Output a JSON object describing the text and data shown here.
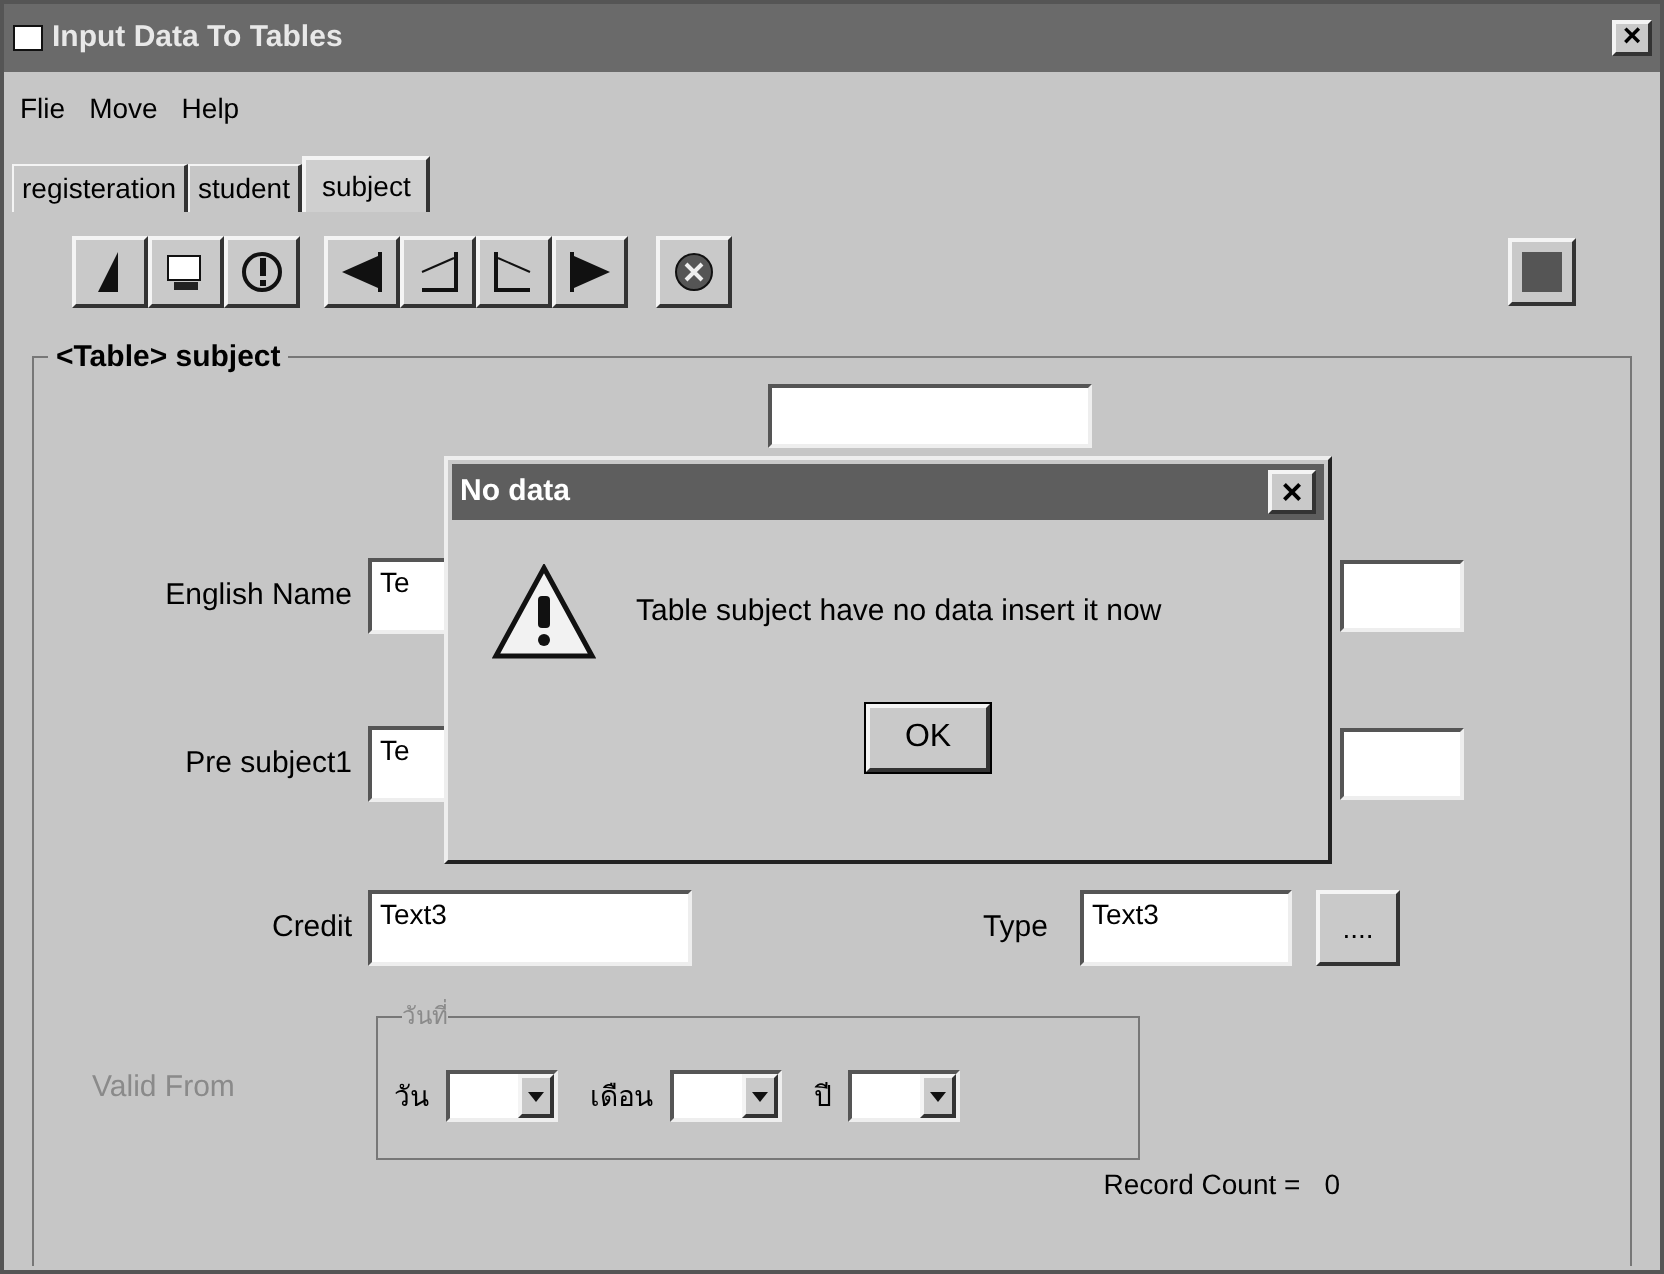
{
  "window": {
    "title": "Input Data To Tables",
    "close": "×"
  },
  "menu": [
    {
      "label": "Flie"
    },
    {
      "label": "Move"
    },
    {
      "label": "Help"
    }
  ],
  "tabs": [
    {
      "label": "registeration",
      "selected": false
    },
    {
      "label": "student",
      "selected": false
    },
    {
      "label": "subject",
      "selected": true
    }
  ],
  "group": {
    "title": "<Table> subject"
  },
  "form": {
    "english_name": {
      "label": "English Name",
      "value": "Te"
    },
    "pre_subject1": {
      "label": "Pre subject1",
      "value": "Te"
    },
    "credit": {
      "label": "Credit",
      "value": "Text3"
    },
    "type": {
      "label": "Type",
      "value": "Text3",
      "button": "...."
    },
    "valid_from": {
      "label": "Valid From",
      "disabled": true,
      "group_title": "วันที่",
      "day": "วัน",
      "month": "เดือน",
      "year": "ปี"
    },
    "record_count": {
      "label": "Record Count =",
      "value": "0"
    }
  },
  "dialog": {
    "title": "No data",
    "close": "×",
    "message": "Table subject have no data insert it now",
    "button": "OK"
  }
}
